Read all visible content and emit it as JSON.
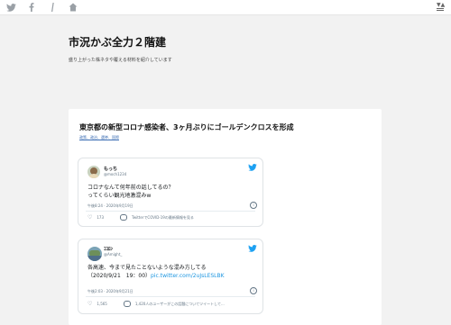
{
  "topbar": {
    "icons": [
      "twitter-icon",
      "facebook-icon",
      "instagram-icon",
      "home-icon"
    ],
    "menu_icon": "menu-icon"
  },
  "header": {
    "title": "市況かぶ全力２階建",
    "description": "盛り上がった株ネタや覆える材料を紹介しています"
  },
  "article": {
    "title": "東京都の新型コロナ感染者、3ヶ月ぶりにゴールデンクロスを形成",
    "tags": "政策、政治、選挙、国際"
  },
  "tweets": [
    {
      "name": "もっち",
      "handle": "@moch1234",
      "lines": [
        "コロナなんて何年前の話してるの？",
        "ってくらい観光地激混みw"
      ],
      "link": "",
      "timestamp": "午後8:24 · 2020年9月19日",
      "likes": "173",
      "extra": "TwitterでCOVID-19の最新情報を見る"
    },
    {
      "name": "ｺｺﾛﾝ",
      "handle": "@Amight_",
      "lines": [
        "各高速、今まで見たことないような混み方してる",
        "（2020/9/21　19：00）"
      ],
      "link": "pic.twitter.com/2uJsLESLBK",
      "timestamp": "午後2:03 · 2020年9月21日",
      "likes": "1,565",
      "extra": "1,420人のユーザーがこの話題についてツイートして..."
    }
  ],
  "colors": {
    "twitter_blue": "#1da1f2",
    "link_blue": "#1b95e0",
    "background": "#f2f2f2"
  }
}
